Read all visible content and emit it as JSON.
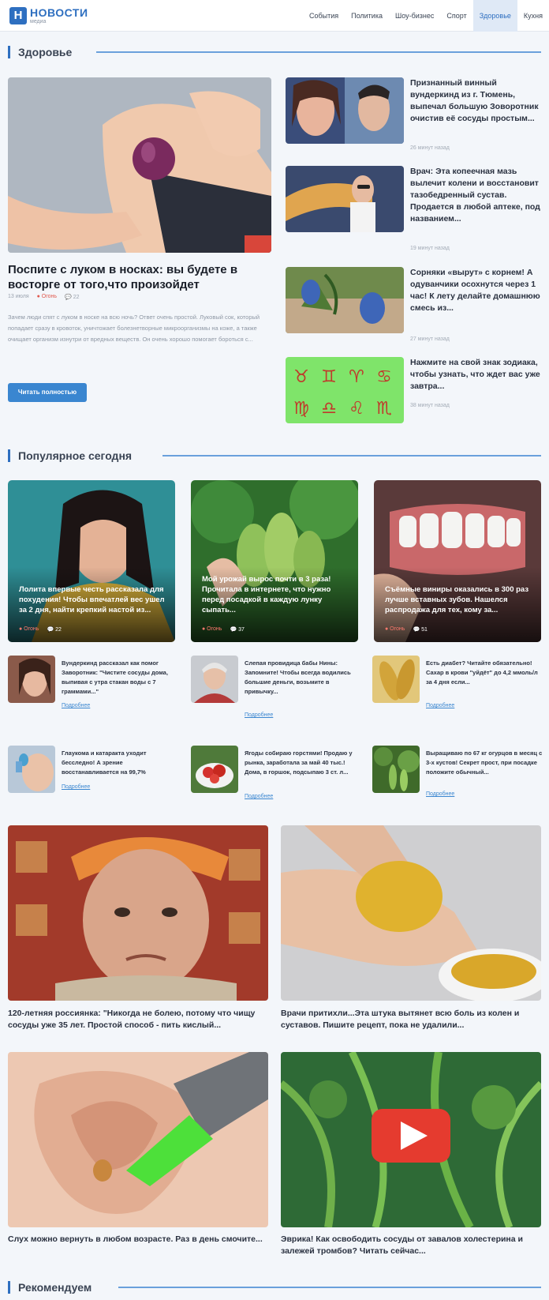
{
  "header": {
    "logo_letter": "Н",
    "logo_title": "НОВОСТИ",
    "logo_sub": "медиа",
    "nav": [
      {
        "label": "События"
      },
      {
        "label": "Политика"
      },
      {
        "label": "Шоу-бизнес"
      },
      {
        "label": "Спорт"
      },
      {
        "label": "Здоровье"
      },
      {
        "label": "Кухня"
      }
    ]
  },
  "section_health": {
    "title": "Здоровье"
  },
  "hero": {
    "title": "Поспите с луком в носках: вы будете в восторге от того,что произойдет",
    "date": "13 июля",
    "tag": "● Огонь",
    "comments": "💬 22",
    "lead": "Зачем люди спят с луком в носке на всю ночь? Ответ очень простой. Луковый сок, который попадает сразу в кровоток, уничтожает болезнетворные микроорганизмы на коже, а также очищает организм изнутри от вредных веществ. Он очень хорошо помогает бороться с...",
    "button": "Читать полностью"
  },
  "side_items": [
    {
      "title": "Признанный винный вундеркинд из г. Тюмень, выпечал большую Зоворотник очистив её сосуды простым...",
      "time": "26 минут назад"
    },
    {
      "title": "Врач: Эта копеечная мазь вылечит колени и восстановит тазобедренный сустав. Продается в любой аптеке, под названием...",
      "time": "19 минут назад"
    },
    {
      "title": "Сорняки «вырут» с корнем! А одуванчики осохнутся через 1 час! К лету делайте домашнюю смесь из...",
      "time": "27 минут назад"
    },
    {
      "title": "Нажмите на свой знак зодиака, чтобы узнать, что ждет вас уже завтра...",
      "time": "38 минут назад"
    }
  ],
  "section_popular": {
    "title": "Популярное сегодня"
  },
  "popular_cards": [
    {
      "title": "Лолита впервые честь рассказала для похудения! Чтобы впечатлей вес ушел за 2 дня, найти крепкий настой из...",
      "tag": "● Огонь",
      "comments": "💬 22"
    },
    {
      "title": "Мой урожай вырос почти в 3 раза! Прочитала в интернете, что нужно перед посадкой в каждую лунку сыпать...",
      "tag": "● Огонь",
      "comments": "💬 37"
    },
    {
      "title": "Съёмные виниры оказались в 300 раз лучше вставных зубов. Нашелся распродажа для тех, кому за...",
      "tag": "● Огонь",
      "comments": "💬 51"
    }
  ],
  "mini_items": [
    {
      "title": "Вундеркинд рассказал как помог Заворотник: \"Чистите сосуды дома, выпивая с утра стакан воды с 7 граммами...\"",
      "more": "Подробнее"
    },
    {
      "title": "Слепая провидица бабы Нины: Запомните! Чтобы всегда водились большие деньги, возьмите в привычку...",
      "more": "Подробнее"
    },
    {
      "title": "Есть диабет? Читайте обязательно! Сахар в крови \"уйдёт\" до 4,2 ммоль/л за 4 дня если...",
      "more": "Подробнее"
    },
    {
      "title": "Глаукома и катаракта уходит бесследно! А зрение восстанавливается на 99,7%",
      "more": "Подробнее"
    },
    {
      "title": "Ягоды собираю горстями! Продаю у рынка, заработала за май 40 тыс.! Дома, в горшок, подсыпаю 3 ст. л...",
      "more": "Подробнее"
    },
    {
      "title": "Выращиваю по 67 кг огурцов в месяц с 3-х кустов! Секрет прост, при посадке положите обычный...",
      "more": "Подробнее"
    }
  ],
  "big_items": [
    {
      "title": "120-летняя россиянка: \"Никогда не болею, потому что чищу сосуды уже 35 лет. Простой способ - пить кислый..."
    },
    {
      "title": "Врачи притихли...Эта штука вытянет всю боль из колен и суставов. Пишите рецепт, пока не удалили..."
    },
    {
      "title": "Слух можно вернуть в любом возрасте. Раз в день смочите..."
    },
    {
      "title": "Эврика! Как освободить сосуды от завалов холестерина и залежей тромбов? Читать сейчас..."
    }
  ],
  "section_recommend": {
    "title": "Рекомендуем"
  },
  "colors": {
    "accent": "#2e6fc0",
    "hot": "#e05a4f",
    "button": "#3a86d0"
  }
}
